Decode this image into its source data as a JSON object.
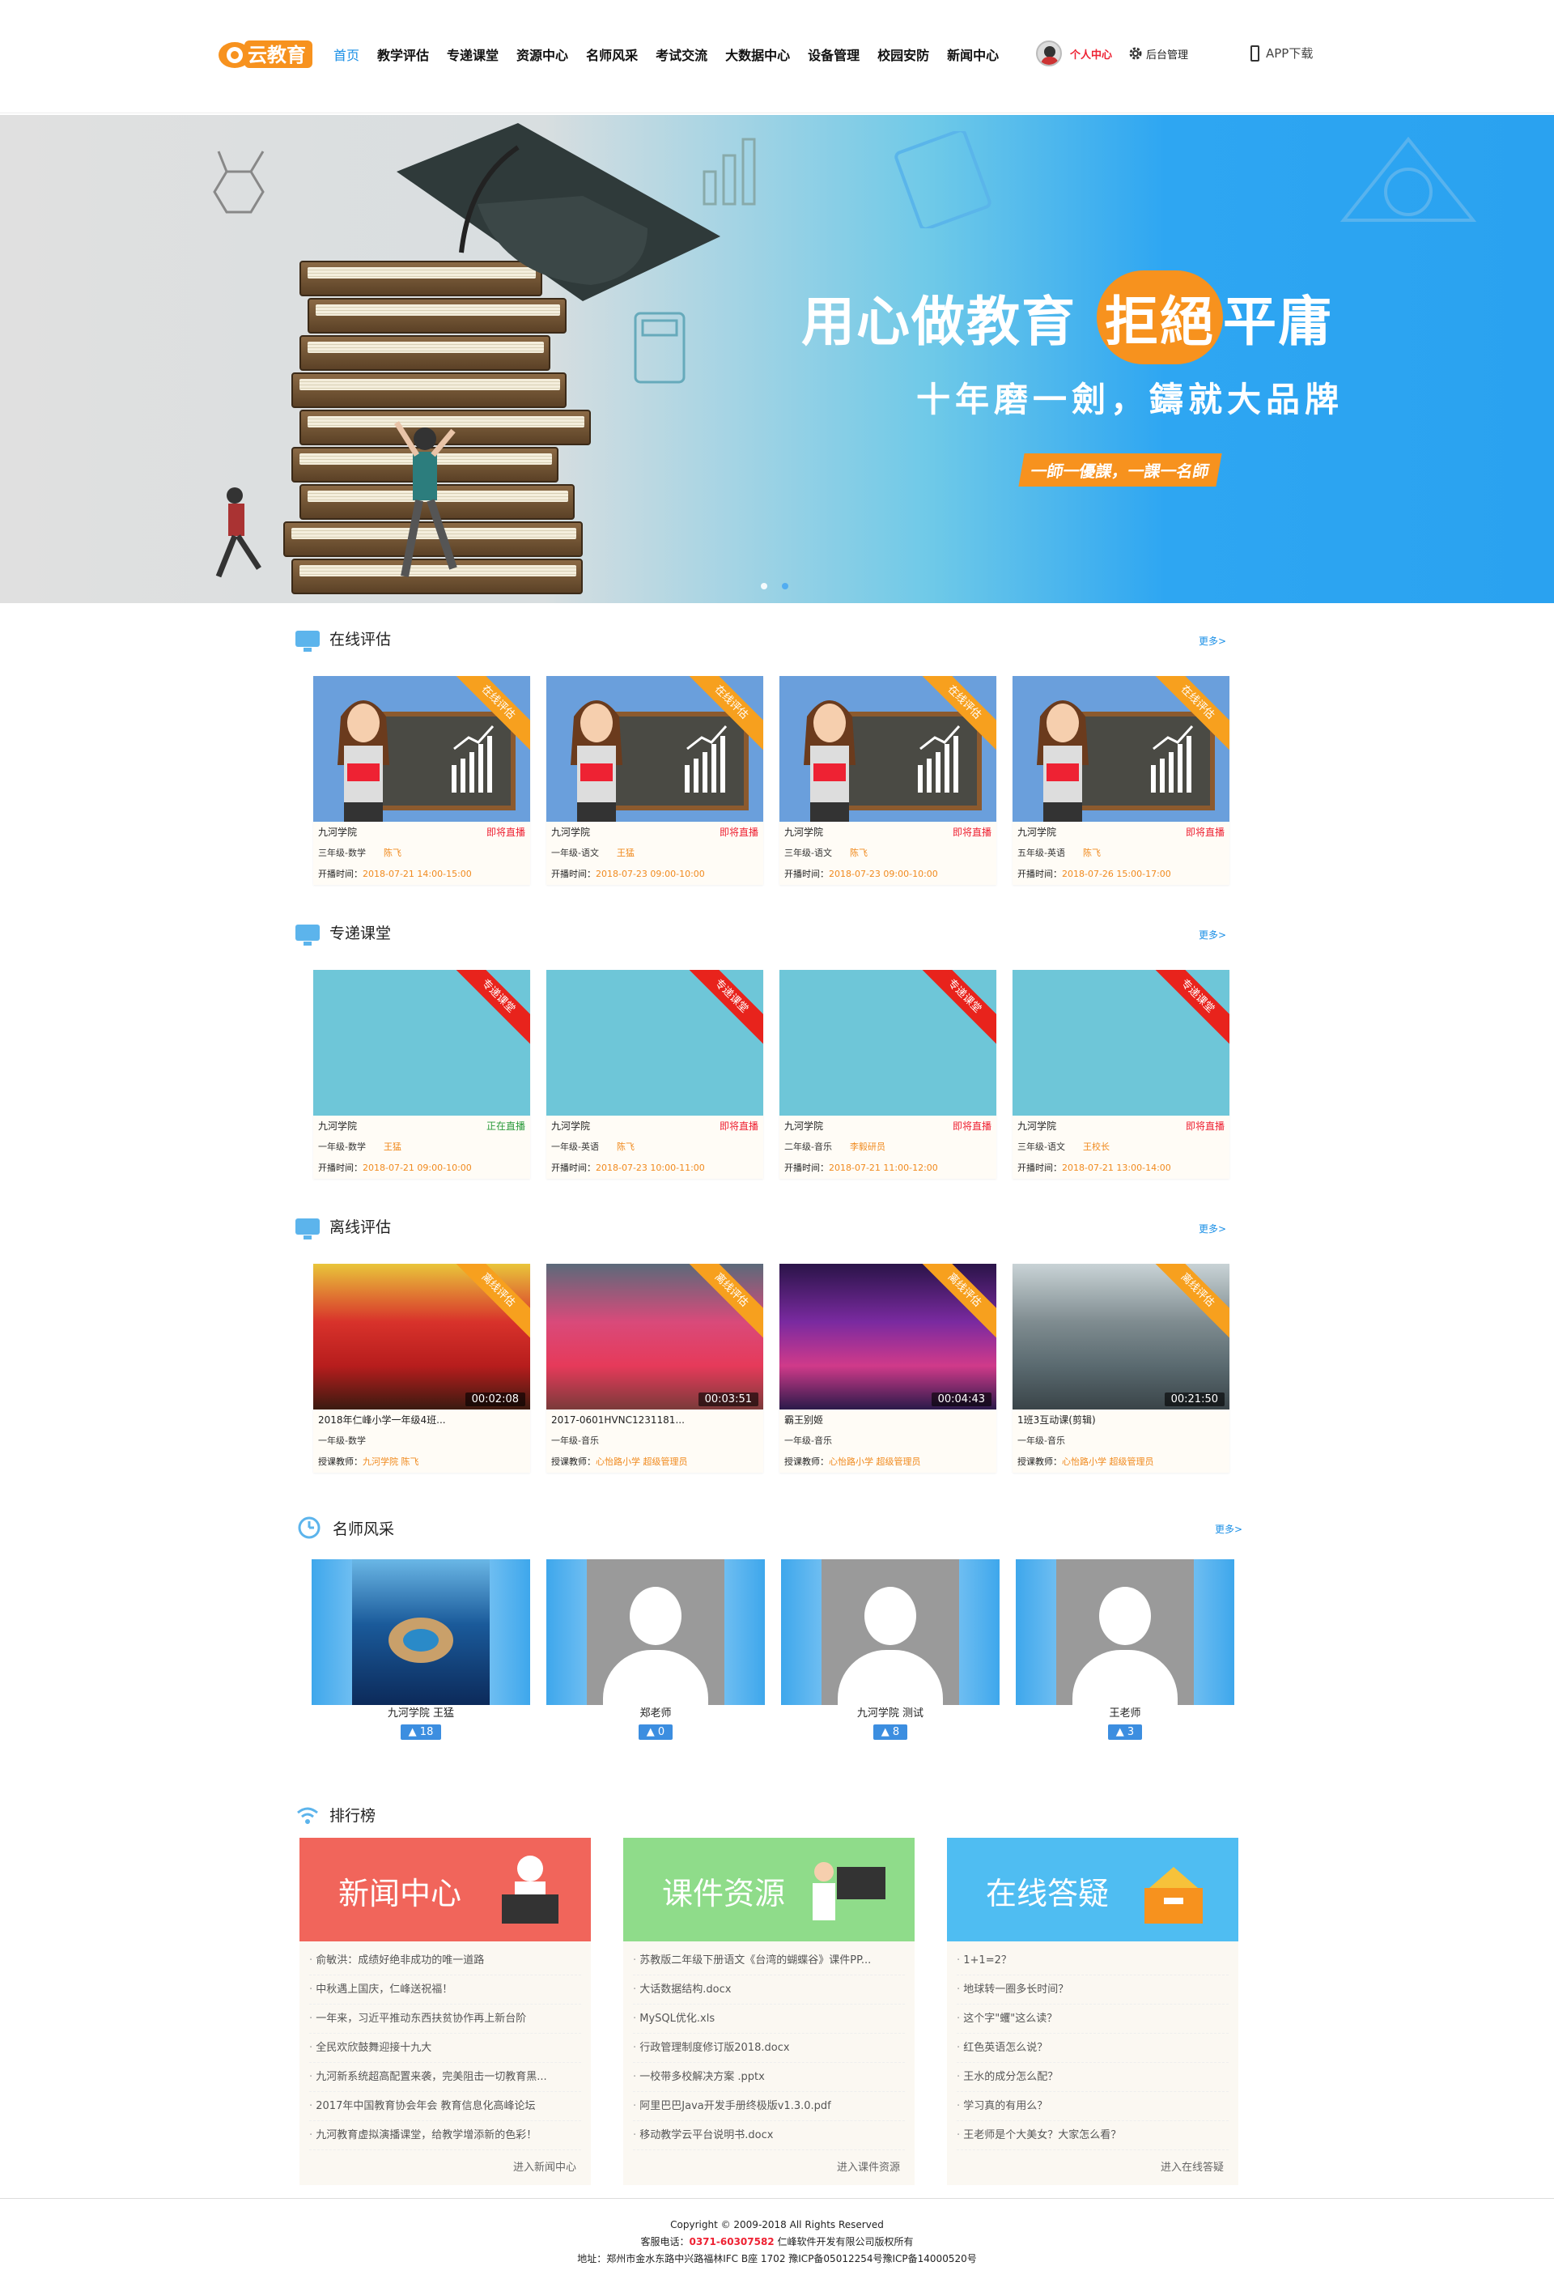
{
  "header": {
    "logo_text": "云教育",
    "nav": [
      "首页",
      "教学评估",
      "专递课堂",
      "资源中心",
      "名师风采",
      "考试交流",
      "大数据中心",
      "设备管理",
      "校园安防",
      "新闻中心"
    ],
    "user_center": "个人中心",
    "admin": "后台管理",
    "app_download": "APP下载"
  },
  "banner": {
    "line1a": "用心做教育",
    "line1b": "拒絕",
    "line1c": "平庸",
    "line2": "十年磨一劍，鑄就大品牌",
    "line3": "一師一優課，一課一名師"
  },
  "sections": {
    "online": {
      "title": "在线评估",
      "more": "更多>",
      "ribbon": "在线评估",
      "cards": [
        {
          "school": "九河学院",
          "status": "即将直播",
          "grade": "三年级-数学",
          "teacher": "陈飞",
          "time_label": "开播时间：",
          "time": "2018-07-21   14:00-15:00"
        },
        {
          "school": "九河学院",
          "status": "即将直播",
          "grade": "一年级-语文",
          "teacher": "王猛",
          "time_label": "开播时间：",
          "time": "2018-07-23   09:00-10:00"
        },
        {
          "school": "九河学院",
          "status": "即将直播",
          "grade": "三年级-语文",
          "teacher": "陈飞",
          "time_label": "开播时间：",
          "time": "2018-07-23   09:00-10:00"
        },
        {
          "school": "九河学院",
          "status": "即将直播",
          "grade": "五年级-英语",
          "teacher": "陈飞",
          "time_label": "开播时间：",
          "time": "2018-07-26   15:00-17:00"
        }
      ]
    },
    "zhuandi": {
      "title": "专递课堂",
      "more": "更多>",
      "ribbon": "专递课堂",
      "cards": [
        {
          "school": "九河学院",
          "status": "正在直播",
          "grade": "一年级-数学",
          "teacher": "王猛",
          "time_label": "开播时间：",
          "time": "2018-07-21   09:00-10:00"
        },
        {
          "school": "九河学院",
          "status": "即将直播",
          "grade": "一年级-英语",
          "teacher": "陈飞",
          "time_label": "开播时间：",
          "time": "2018-07-23   10:00-11:00"
        },
        {
          "school": "九河学院",
          "status": "即将直播",
          "grade": "二年级-音乐",
          "teacher": "李毅研员",
          "time_label": "开播时间：",
          "time": "2018-07-21   11:00-12:00"
        },
        {
          "school": "九河学院",
          "status": "即将直播",
          "grade": "三年级-语文",
          "teacher": "王校长",
          "time_label": "开播时间：",
          "time": "2018-07-21   13:00-14:00"
        }
      ]
    },
    "offline": {
      "title": "离线评估",
      "more": "更多>",
      "ribbon": "离线评估",
      "cards": [
        {
          "title": "2018年仁峰小学一年级4班...",
          "duration": "00:02:08",
          "grade": "一年级-数学",
          "label": "授课教师：",
          "teacher": "九河学院  陈飞"
        },
        {
          "title": "2017-0601HVNC1231181...",
          "duration": "00:03:51",
          "grade": "一年级-音乐",
          "label": "授课教师：",
          "teacher": "心怡路小学  超级管理员"
        },
        {
          "title": "霸王别姬",
          "duration": "00:04:43",
          "grade": "一年级-音乐",
          "label": "授课教师：",
          "teacher": "心怡路小学  超级管理员"
        },
        {
          "title": "1班3互动课(剪辑)",
          "duration": "00:21:50",
          "grade": "一年级-音乐",
          "label": "授课教师：",
          "teacher": "心怡路小学  超级管理员"
        }
      ]
    },
    "teachers": {
      "title": "名师风采",
      "more": "更多>",
      "cards": [
        {
          "name": "九河学院   王猛",
          "likes": "18"
        },
        {
          "name": "郑老师",
          "likes": "0"
        },
        {
          "name": "九河学院   测试",
          "likes": "8"
        },
        {
          "name": "王老师",
          "likes": "3"
        }
      ]
    },
    "rank": {
      "title": "排行榜",
      "cols": [
        {
          "head": "新闻中心",
          "color": "#f1655b",
          "more": "进入新闻中心",
          "items": [
            "俞敏洪：成绩好绝非成功的唯一道路",
            "中秋遇上国庆，仁峰送祝福！",
            "一年来，习近平推动东西扶贫协作再上新台阶",
            "全民欢欣鼓舞迎接十九大",
            "九河新系统超高配置来袭，完美阻击一切教育黑...",
            "2017年中国教育协会年会 教育信息化高峰论坛",
            "九河教育虚拟演播课堂，给教学增添新的色彩！"
          ]
        },
        {
          "head": "课件资源",
          "color": "#8fdc8a",
          "more": "进入课件资源",
          "items": [
            "苏教版二年级下册语文《台湾的蝴蝶谷》课件PP...",
            "大话数据结构.docx",
            "MySQL优化.xls",
            "行政管理制度修订版2018.docx",
            "一校带多校解决方案 .pptx",
            "阿里巴巴Java开发手册终极版v1.3.0.pdf",
            "移动教学云平台说明书.docx"
          ]
        },
        {
          "head": "在线答疑",
          "color": "#4fbdf2",
          "more": "进入在线答疑",
          "items": [
            "1+1=2？",
            "地球转一圈多长时间？",
            "这个字\"蠼\"这么读？",
            "红色英语怎么说？",
            "王水的成分怎么配？",
            "学习真的有用么？",
            "王老师是个大美女？大家怎么看？"
          ]
        }
      ]
    }
  },
  "footer": {
    "copyright": "Copyright © 2009-2018 All Rights Reserved",
    "tel_label": "客服电话：",
    "tel": "0371-60307582",
    "company": "仁峰软件开发有限公司版权所有",
    "address": "地址：郑州市金水东路中兴路福林IFC B座 1702   豫ICP备05012254号豫ICP备14000520号"
  }
}
